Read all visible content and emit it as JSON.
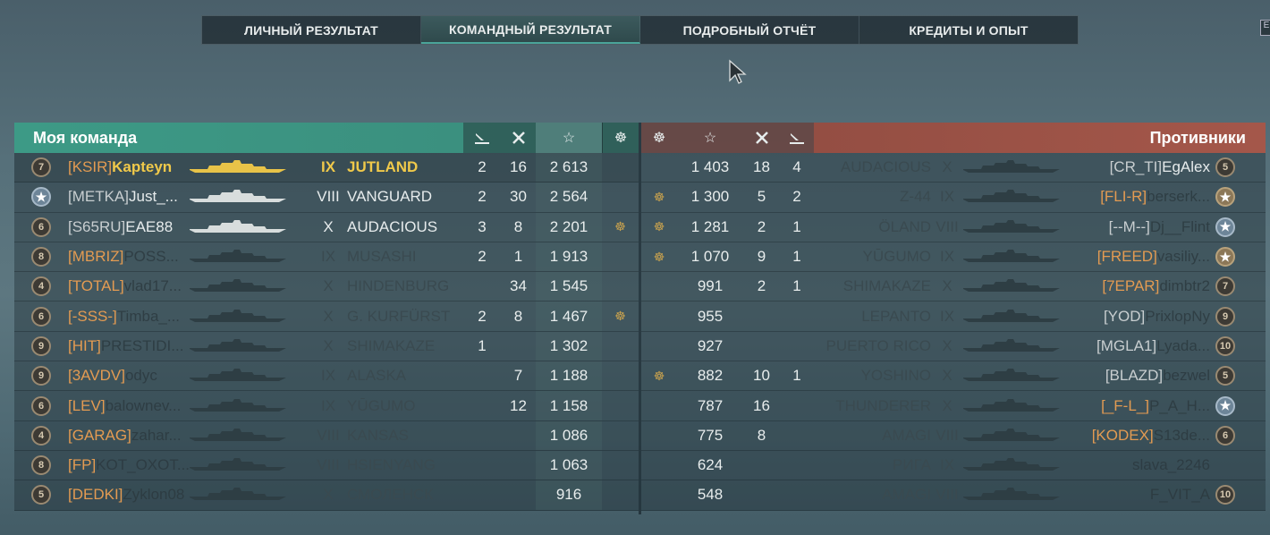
{
  "tabs": [
    {
      "label": "ЛИЧНЫЙ РЕЗУЛЬТАТ",
      "active": false
    },
    {
      "label": "КОМАНДНЫЙ РЕЗУЛЬТАТ",
      "active": true
    },
    {
      "label": "ПОДРОБНЫЙ ОТЧЁТ",
      "active": false
    },
    {
      "label": "КРЕДИТЫ И ОПЫТ",
      "active": false
    }
  ],
  "corner_label": "E",
  "my_team": {
    "title": "Моя команда",
    "header_icons": [
      "plane-icon",
      "aircraft-shot-icon",
      "star-icon",
      "base-capture-icon"
    ],
    "rows": [
      {
        "level": "7",
        "level_type": "normal",
        "clan": "[KSIR]",
        "name": "Kapteyn",
        "tier": "IX",
        "ship": "JUTLAND",
        "c1": "2",
        "c2": "16",
        "xp": "2 613",
        "medal": "",
        "self": true
      },
      {
        "level": "★",
        "level_type": "star",
        "clan": "[METKA]",
        "name": "Just_...",
        "tier": "VIII",
        "ship": "VANGUARD",
        "c1": "2",
        "c2": "30",
        "xp": "2 564",
        "medal": "",
        "light": true,
        "clan_grey": true
      },
      {
        "level": "6",
        "level_type": "normal",
        "clan": "[S65RU]",
        "name": "EAE88",
        "tier": "X",
        "ship": "AUDACIOUS",
        "c1": "3",
        "c2": "8",
        "xp": "2 201",
        "medal": "☸",
        "light": true,
        "clan_grey": true
      },
      {
        "level": "8",
        "level_type": "normal",
        "clan": "[MBRIZ]",
        "name": "POSS...",
        "tier": "IX",
        "ship": "MUSASHI",
        "c1": "2",
        "c2": "1",
        "xp": "1 913",
        "medal": ""
      },
      {
        "level": "4",
        "level_type": "normal",
        "clan": "[TOTAL]",
        "name": "vlad17...",
        "tier": "X",
        "ship": "HINDENBURG",
        "c1": "",
        "c2": "34",
        "xp": "1 545",
        "medal": ""
      },
      {
        "level": "6",
        "level_type": "normal",
        "clan": "[-SSS-]",
        "name": "Timba_...",
        "tier": "X",
        "ship": "G. KURFÜRST",
        "c1": "2",
        "c2": "8",
        "xp": "1 467",
        "medal": "☸"
      },
      {
        "level": "9",
        "level_type": "normal",
        "clan": "[HIT]",
        "name": "PRESTIDI...",
        "tier": "X",
        "ship": "SHIMAKAZE",
        "c1": "1",
        "c2": "",
        "xp": "1 302",
        "medal": ""
      },
      {
        "level": "9",
        "level_type": "normal",
        "clan": "[3AVDV]",
        "name": "odyc",
        "tier": "IX",
        "ship": "ALASKA",
        "c1": "",
        "c2": "7",
        "xp": "1 188",
        "medal": ""
      },
      {
        "level": "6",
        "level_type": "normal",
        "clan": "[LEV]",
        "name": "balownev...",
        "tier": "IX",
        "ship": "YŪGUMO",
        "c1": "",
        "c2": "12",
        "xp": "1 158",
        "medal": ""
      },
      {
        "level": "4",
        "level_type": "normal",
        "clan": "[GARAG]",
        "name": "zahar...",
        "tier": "VIII",
        "ship": "KANSAS",
        "c1": "",
        "c2": "",
        "xp": "1 086",
        "medal": ""
      },
      {
        "level": "8",
        "level_type": "normal",
        "clan": "[FP]",
        "name": "KOT_OXOT...",
        "tier": "VIII",
        "ship": "HSIENYANG",
        "c1": "",
        "c2": "",
        "xp": "1 063",
        "medal": ""
      },
      {
        "level": "5",
        "level_type": "normal",
        "clan": "[DEDKI]",
        "name": "Zyklon08",
        "tier": "X",
        "ship": "СМОЛЕНСК",
        "c1": "",
        "c2": "",
        "xp": "916",
        "medal": ""
      }
    ]
  },
  "enemy_team": {
    "title": "Противники",
    "header_icons": [
      "base-capture-icon",
      "star-icon",
      "aircraft-shot-icon",
      "plane-icon"
    ],
    "rows": [
      {
        "medal": "",
        "xp": "1 403",
        "c2": "18",
        "c1": "4",
        "ship": "AUDACIOUS",
        "tier": "X",
        "clan": "[CR_TI]",
        "name": "EgAlex",
        "level": "5",
        "level_type": "normal",
        "clan_grey": true,
        "light": true
      },
      {
        "medal": "☸",
        "xp": "1 300",
        "c2": "5",
        "c1": "2",
        "ship": "Z-44",
        "tier": "IX",
        "clan": "[FLI-R]",
        "name": "berserk...",
        "level": "★",
        "level_type": "star-gold"
      },
      {
        "medal": "☸",
        "xp": "1 281",
        "c2": "2",
        "c1": "1",
        "ship": "ÖLAND",
        "tier": "VIII",
        "clan": "[--M--]",
        "name": "Dj__Flint",
        "level": "★",
        "level_type": "star",
        "clan_grey": true
      },
      {
        "medal": "☸",
        "xp": "1 070",
        "c2": "9",
        "c1": "1",
        "ship": "YŪGUMO",
        "tier": "IX",
        "clan": "[FREED]",
        "name": "vasiliy...",
        "level": "★",
        "level_type": "star-gold"
      },
      {
        "medal": "",
        "xp": "991",
        "c2": "2",
        "c1": "1",
        "ship": "SHIMAKAZE",
        "tier": "X",
        "clan": "[7EPAR]",
        "name": "dimbtr2",
        "level": "7",
        "level_type": "normal"
      },
      {
        "medal": "",
        "xp": "955",
        "c2": "",
        "c1": "",
        "ship": "LEPANTO",
        "tier": "IX",
        "clan": "[YOD]",
        "name": "PrixlopNy",
        "level": "9",
        "level_type": "normal",
        "clan_grey": true
      },
      {
        "medal": "",
        "xp": "927",
        "c2": "",
        "c1": "",
        "ship": "PUERTO RICO",
        "tier": "X",
        "clan": "[MGLA1]",
        "name": "Lyada...",
        "level": "10",
        "level_type": "normal",
        "clan_grey": true
      },
      {
        "medal": "☸",
        "xp": "882",
        "c2": "10",
        "c1": "1",
        "ship": "YOSHINO",
        "tier": "X",
        "clan": "[BLAZD]",
        "name": "bezwel",
        "level": "5",
        "level_type": "normal",
        "clan_grey": true
      },
      {
        "medal": "",
        "xp": "787",
        "c2": "16",
        "c1": "",
        "ship": "THUNDERER",
        "tier": "X",
        "clan": "[_F-L_]",
        "name": "P_A_H...",
        "level": "★",
        "level_type": "star"
      },
      {
        "medal": "",
        "xp": "775",
        "c2": "8",
        "c1": "",
        "ship": "AMAGI",
        "tier": "VIII",
        "clan": "[KODEX]",
        "name": "S13de...",
        "level": "6",
        "level_type": "normal"
      },
      {
        "medal": "",
        "xp": "624",
        "c2": "",
        "c1": "",
        "ship": "РИГА",
        "tier": "IX",
        "clan": "",
        "name": "slava_2246",
        "level": "",
        "level_type": "none"
      },
      {
        "medal": "",
        "xp": "548",
        "c2": "",
        "c1": "",
        "ship": "AMAGI",
        "tier": "VIII",
        "clan": "",
        "name": "F_VIT_A",
        "level": "10",
        "level_type": "normal"
      }
    ]
  },
  "colors": {
    "ally_header": "#3d9a86",
    "enemy_header": "#a4574a",
    "self_highlight": "#f0c94a",
    "clan_tag": "#e39b52"
  }
}
